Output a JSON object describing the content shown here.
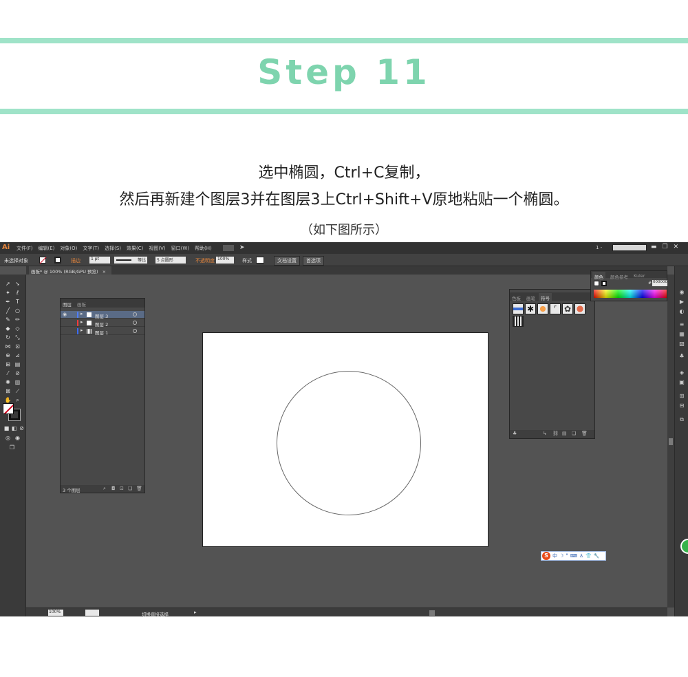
{
  "header": {
    "title": "Step 11",
    "line1": "选中椭圆，Ctrl+C复制，",
    "line2": "然后再新建个图层3并在图层3上Ctrl+Shift+V原地粘贴一个椭圆。",
    "line3": "（如下图所示）"
  },
  "menubar": {
    "logo": "Ai",
    "items": [
      "文件(F)",
      "编辑(E)",
      "对象(O)",
      "文字(T)",
      "选择(S)",
      "效果(C)",
      "视图(V)",
      "窗口(W)",
      "帮助(H)"
    ],
    "workspace": "1 -"
  },
  "control_bar": {
    "selection": "未选择对象",
    "stroke_label": "描边",
    "stroke_weight": "1 pt",
    "profile": "等比",
    "brush": "5 点圆形",
    "opacity_label": "不透明度",
    "opacity_value": "100%",
    "style_label": "样式",
    "doc_setup": "文档设置",
    "preferences": "首选项"
  },
  "document_tab": {
    "label": "画板* @ 100% (RGB/GPU 预览)",
    "close": "×"
  },
  "layers_panel": {
    "tabs": [
      "图层",
      "画板"
    ],
    "layers": [
      {
        "name": "图层 3",
        "color": "#4f7dff",
        "selected": true
      },
      {
        "name": "图层 2",
        "color": "#ff3b3b",
        "selected": false
      },
      {
        "name": "图层 1",
        "color": "#3b6cff",
        "selected": false
      }
    ],
    "count": "3 个图层"
  },
  "symbols_panel": {
    "tabs": [
      "色板",
      "画笔",
      "符号"
    ],
    "active_tab": "符号"
  },
  "color_panel": {
    "tabs": [
      "颜色",
      "颜色参考",
      "Kuler"
    ],
    "hex": "000000"
  },
  "status_bar": {
    "zoom": "100%",
    "tool": "切换直接选择"
  },
  "ime": {
    "logo": "S",
    "items": [
      "中",
      "☽",
      "°",
      "⌨",
      "♙",
      "👕",
      "🔧"
    ]
  },
  "colors": {
    "accent": "#7ed4ae",
    "bar": "#9fe3c8",
    "ui_dark": "#535353"
  }
}
